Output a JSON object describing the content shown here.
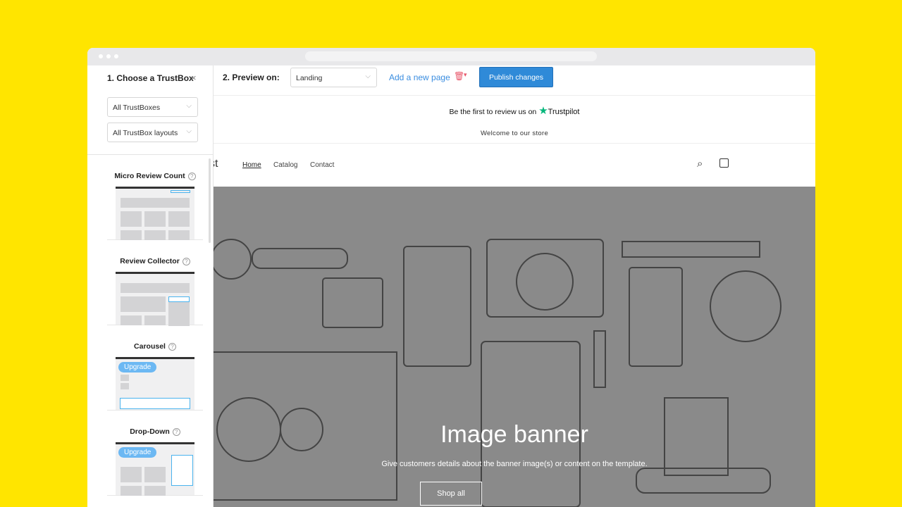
{
  "sidebar": {
    "title": "1. Choose a TrustBox",
    "close": "×",
    "filter1": "All TrustBoxes",
    "filter2": "All TrustBox layouts",
    "items": [
      {
        "label": "Micro Review Count",
        "upgrade": ""
      },
      {
        "label": "Review Collector",
        "upgrade": ""
      },
      {
        "label": "Carousel",
        "upgrade": "Upgrade"
      },
      {
        "label": "Drop-Down",
        "upgrade": "Upgrade"
      }
    ]
  },
  "toolbar": {
    "preview_label": "2. Preview on:",
    "page": "Landing",
    "add_page": "Add a new page",
    "publish": "Publish changes"
  },
  "store": {
    "trustpilot_text": "Be the first to review us on",
    "trustpilot_brand": "Trustpilot",
    "announcement": "Welcome to our store",
    "logo_fragment": "st",
    "nav": [
      "Home",
      "Catalog",
      "Contact"
    ],
    "banner_title": "Image banner",
    "banner_text": "Give customers details about the banner image(s) or content on the template.",
    "banner_button": "Shop all"
  },
  "colors": {
    "background": "#ffe500",
    "accent": "#2f8ad8",
    "trustpilot": "#00b67a"
  }
}
